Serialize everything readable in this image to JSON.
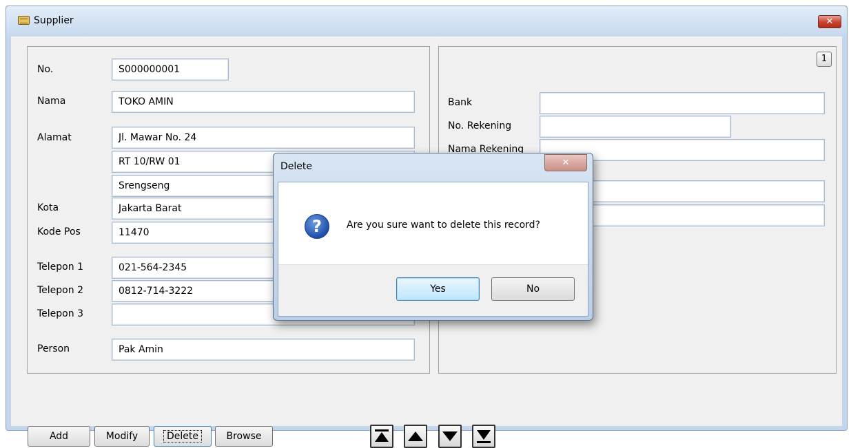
{
  "window": {
    "title": "Supplier",
    "close_symbol": "✕",
    "icon": "folder-icon"
  },
  "left_form": {
    "no_label": "No.",
    "no_value": "S000000001",
    "nama_label": "Nama",
    "nama_value": "TOKO AMIN",
    "alamat_label": "Alamat",
    "alamat_lines": [
      "Jl. Mawar No. 24",
      "RT 10/RW 01",
      "Srengseng"
    ],
    "kota_label": "Kota",
    "kota_value": "Jakarta Barat",
    "kodepos_label": "Kode Pos",
    "kodepos_value": "11470",
    "telepon1_label": "Telepon 1",
    "telepon1_value": "021-564-2345",
    "telepon2_label": "Telepon 2",
    "telepon2_value": "0812-714-3222",
    "telepon3_label": "Telepon 3",
    "telepon3_value": "",
    "person_label": "Person",
    "person_value": "Pak Amin"
  },
  "right_form": {
    "page_number": "1",
    "bank_label": "Bank",
    "bank_value": "",
    "rekening_label": "No. Rekening",
    "rekening_value": "",
    "nama_rekening_label": "Nama Rekening",
    "nama_rekening_value": "",
    "field4_value": "",
    "field5_value": ""
  },
  "toolbar": {
    "add": "Add",
    "modify": "Modify",
    "delete": "Delete",
    "browse": "Browse",
    "nav_icons": [
      "first-record-icon",
      "previous-record-icon",
      "next-record-icon",
      "last-record-icon"
    ]
  },
  "dialog": {
    "title": "Delete",
    "close_symbol": "✕",
    "message": "Are you sure want to delete this record?",
    "icon": "question-icon",
    "icon_glyph": "?",
    "yes": "Yes",
    "no": "No"
  }
}
